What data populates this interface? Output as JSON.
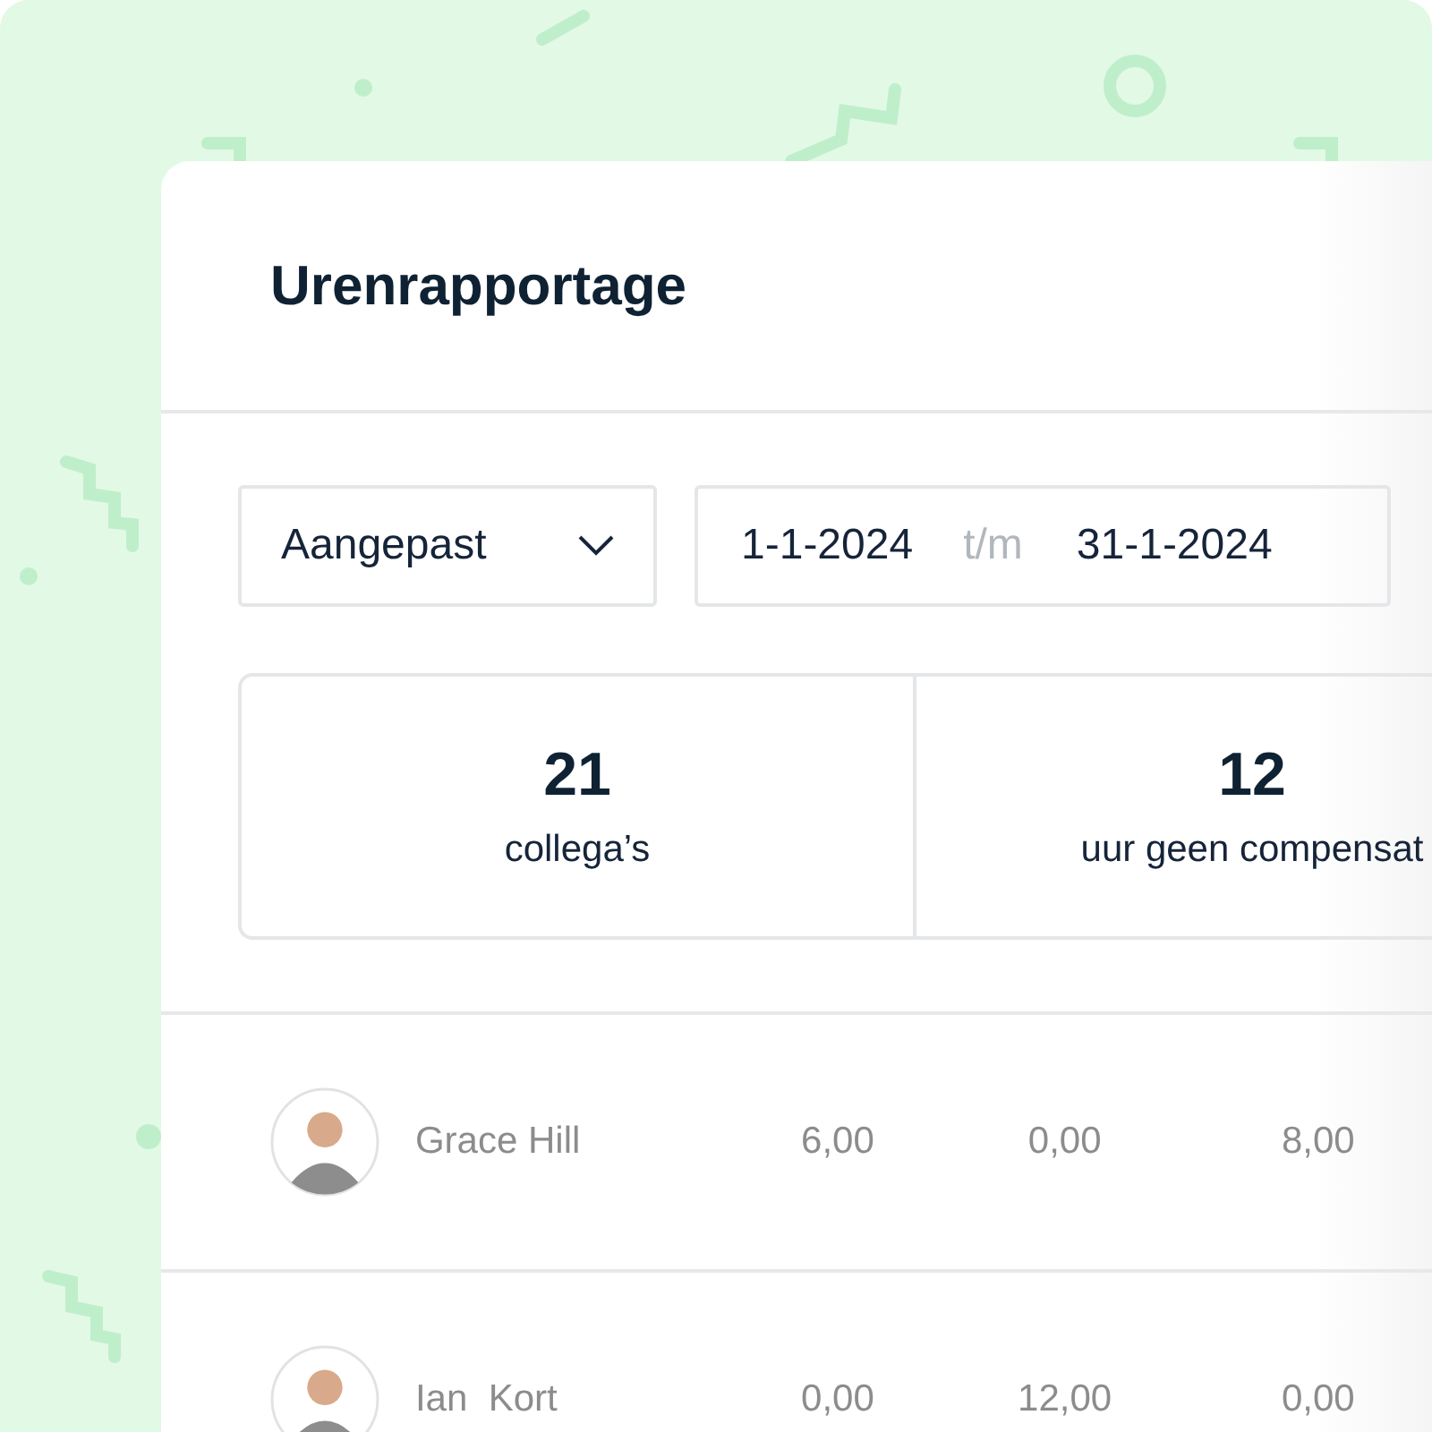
{
  "title": "Urenrapportage",
  "filter": {
    "period": "Aangepast",
    "from": "1-1-2024",
    "separator": "t/m",
    "to": "31-1-2024"
  },
  "stats": [
    {
      "value": "21",
      "label": "collega’s"
    },
    {
      "value": "12",
      "label": "uur geen compensat"
    }
  ],
  "rows": [
    {
      "name": "Grace Hill",
      "values": [
        "6,00",
        "0,00",
        "8,00"
      ]
    },
    {
      "name": "Ian  Kort",
      "values": [
        "0,00",
        "12,00",
        "0,00"
      ]
    }
  ]
}
